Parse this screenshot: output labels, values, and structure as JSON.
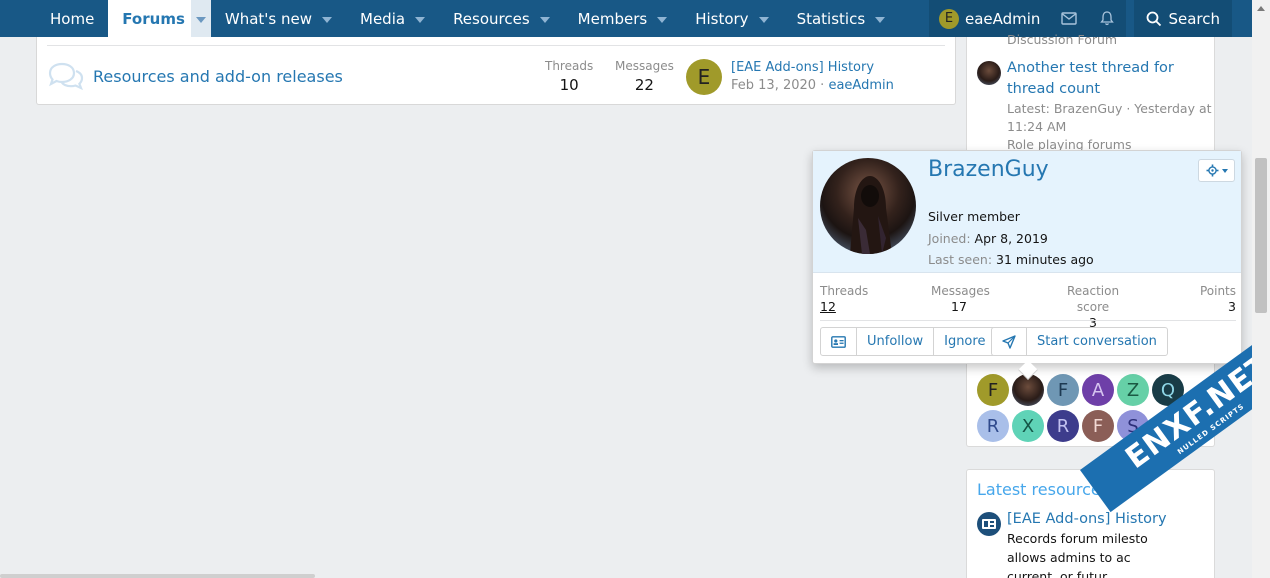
{
  "nav": {
    "items": [
      {
        "label": "Home"
      },
      {
        "label": "Forums",
        "active": true
      },
      {
        "label": "What's new"
      },
      {
        "label": "Media"
      },
      {
        "label": "Resources"
      },
      {
        "label": "Members"
      },
      {
        "label": "History"
      },
      {
        "label": "Statistics"
      }
    ],
    "user": {
      "initial": "E",
      "name": "eaeAdmin"
    },
    "search_label": "Search"
  },
  "node": {
    "title": "Resources and add-on releases",
    "threads_label": "Threads",
    "threads": "10",
    "messages_label": "Messages",
    "messages": "22",
    "last_avatar_initial": "E",
    "last_title": "[EAE Add-ons] History",
    "last_date": "Feb 13, 2020",
    "last_sep": " · ",
    "last_user": "eaeAdmin"
  },
  "sidebar": {
    "top_text": "Discussion Forum",
    "thread_title": "Another test thread for thread count",
    "thread_title_l1": "Another test thread for",
    "thread_title_l2": "thread count",
    "latest_l1": "Latest: BrazenGuy · Yesterday at",
    "latest_l2": "11:24 AM",
    "forum": "Role playing forums",
    "avatars": [
      {
        "letter": "F",
        "bg": "#a09a2a",
        "fg": "#222222"
      },
      {
        "letter": "",
        "bg": "dark",
        "fg": "#ffffff"
      },
      {
        "letter": "F",
        "bg": "#6f97b4",
        "fg": "#1d3a52"
      },
      {
        "letter": "A",
        "bg": "#6e3fa8",
        "fg": "#d6c4f0"
      },
      {
        "letter": "Z",
        "bg": "#66d0a7",
        "fg": "#1b5a43"
      },
      {
        "letter": "Q",
        "bg": "#193c47",
        "fg": "#8fd6e6"
      },
      {
        "letter": "R",
        "bg": "#a9bfe9",
        "fg": "#2f4a8c"
      },
      {
        "letter": "X",
        "bg": "#5fd3b7",
        "fg": "#145647"
      },
      {
        "letter": "R",
        "bg": "#3d3c8c",
        "fg": "#c2c1f0"
      },
      {
        "letter": "F",
        "bg": "#8b5e57",
        "fg": "#f2d8d3"
      },
      {
        "letter": "S",
        "bg": "#8f91d9",
        "fg": "#2c2e78"
      }
    ],
    "latest_resources_heading": "Latest resources",
    "resource_title": "[EAE Add-ons] History",
    "resource_l1": "Records forum milesto",
    "resource_l2": "allows admins to ac",
    "resource_l3": "current, or futur"
  },
  "tooltip": {
    "name": "BrazenGuy",
    "user_title": "Silver member",
    "joined_label": "Joined: ",
    "joined": "Apr 8, 2019",
    "seen_label": "Last seen: ",
    "seen": "31 minutes ago",
    "stats": [
      {
        "label": "Threads",
        "value": "12"
      },
      {
        "label": "Messages",
        "value": "17"
      },
      {
        "label": "Reaction score",
        "value": "3"
      },
      {
        "label": "Points",
        "value": "3"
      }
    ],
    "buttons": {
      "unfollow": "Unfollow",
      "ignore": "Ignore",
      "start_conversation": "Start conversation"
    }
  },
  "watermark": {
    "big": "ENXF.NET",
    "small": "NULLED SCRIPTS"
  }
}
